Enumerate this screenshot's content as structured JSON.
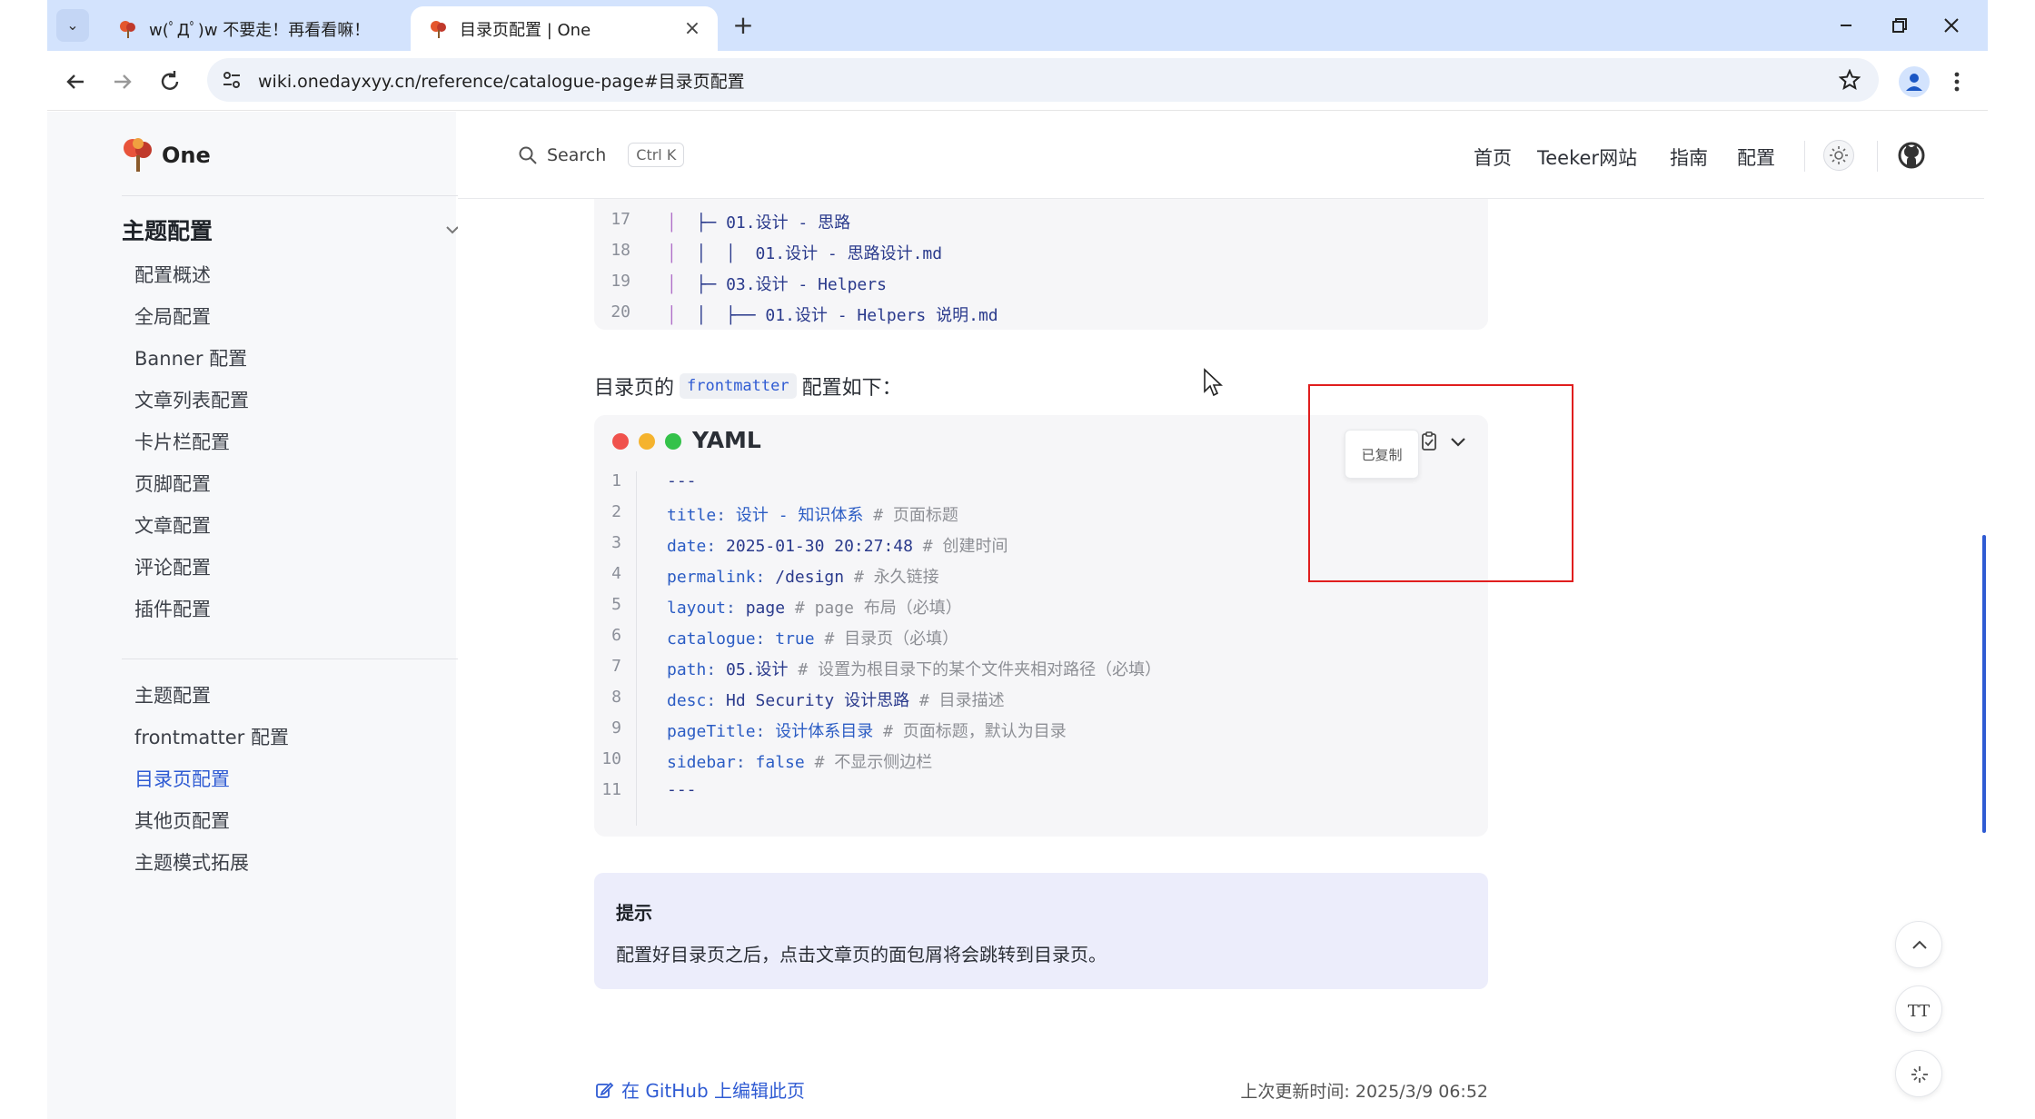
{
  "browser": {
    "tabs": [
      {
        "title": "w(ﾟДﾟ)w 不要走！再看看嘛！"
      },
      {
        "title": "目录页配置 | One"
      }
    ],
    "url": "wiki.onedayxyy.cn/reference/catalogue-page#目录页配置",
    "new_tab_symbol": "+"
  },
  "site": {
    "logo_text": "One",
    "search_label": "Search",
    "search_shortcut": "Ctrl K",
    "nav": [
      "首页",
      "Teeker网站",
      "指南",
      "配置"
    ]
  },
  "sidebar": {
    "group_title": "主题配置",
    "group_items": [
      "配置概述",
      "全局配置",
      "Banner 配置",
      "文章列表配置",
      "卡片栏配置",
      "页脚配置",
      "文章配置",
      "评论配置",
      "插件配置"
    ],
    "items": [
      "主题配置",
      "frontmatter 配置",
      "目录页配置",
      "其他页配置",
      "主题模式拓展"
    ],
    "active": "目录页配置"
  },
  "tree_block": {
    "line_numbers": [
      "17",
      "18",
      "19",
      "20"
    ]
  },
  "paragraph": {
    "before": "目录页的",
    "code": "frontmatter",
    "after": "配置如下："
  },
  "yaml_block": {
    "lang": "YAML",
    "copied_label": "已复制",
    "line_numbers": [
      "1",
      "2",
      "3",
      "4",
      "5",
      "6",
      "7",
      "8",
      "9",
      "10",
      "11"
    ]
  },
  "tip": {
    "title": "提示",
    "text": "配置好目录页之后，点击文章页的面包屑将会跳转到目录页。"
  },
  "footer": {
    "edit_link": "在 GitHub 上编辑此页",
    "last_updated": "上次更新时间: 2025/3/9 06:52"
  },
  "float_buttons": {
    "font_size_label": "TT"
  },
  "colors": {
    "accent": "#2f5bd3",
    "highlight_box": "#e01e1e",
    "tip_bg": "#ecedfb",
    "tab_strip": "#d3e3fd"
  }
}
